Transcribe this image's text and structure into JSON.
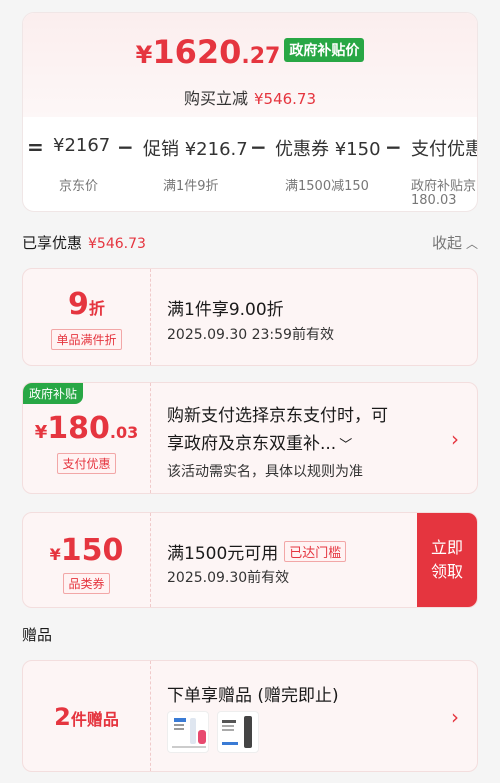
{
  "price": {
    "yen": "¥",
    "integer": "1620",
    "decimal": ".27",
    "badge": "政府补贴价",
    "reduce_label": "购买立减",
    "reduce_amount": "¥546.73"
  },
  "formula": {
    "eq": "=",
    "minus": "−",
    "items": [
      {
        "value": "¥2167",
        "label": "京东价"
      },
      {
        "value": "促销 ¥216.7",
        "label": "满1件9折"
      },
      {
        "value": "优惠券 ¥150",
        "label": "满1500减150"
      },
      {
        "value": "支付优惠",
        "label": "政府补贴京",
        "sub": "180.03"
      }
    ]
  },
  "discounts": {
    "title": "已享优惠",
    "amount": "¥546.73",
    "collapse_label": "收起"
  },
  "coupons": [
    {
      "big": "9",
      "unit": "折",
      "tag": "单品满件折",
      "title": "满1件享9.00折",
      "sub": "2025.09.30 23:59前有效"
    },
    {
      "corner": "政府补贴",
      "yen": "¥",
      "big": "180",
      "decimal": ".03",
      "tag": "支付优惠",
      "title_line1": "购新支付选择京东支付时，可",
      "title_line2": "享政府及京东双重补...",
      "sub": "该活动需实名，具体以规则为准",
      "arrow": "›"
    },
    {
      "yen": "¥",
      "big": "150",
      "tag": "品类券",
      "title": "满1500元可用",
      "status": "已达门槛",
      "sub": "2025.09.30前有效",
      "button_line1": "立即",
      "button_line2": "领取"
    }
  ],
  "gifts": {
    "section_title": "赠品",
    "count": "2",
    "unit": "件赠品",
    "title": "下单享赠品 (赠完即止)",
    "arrow": "›"
  },
  "colors": {
    "accent": "#e5353f",
    "green": "#28a745"
  }
}
